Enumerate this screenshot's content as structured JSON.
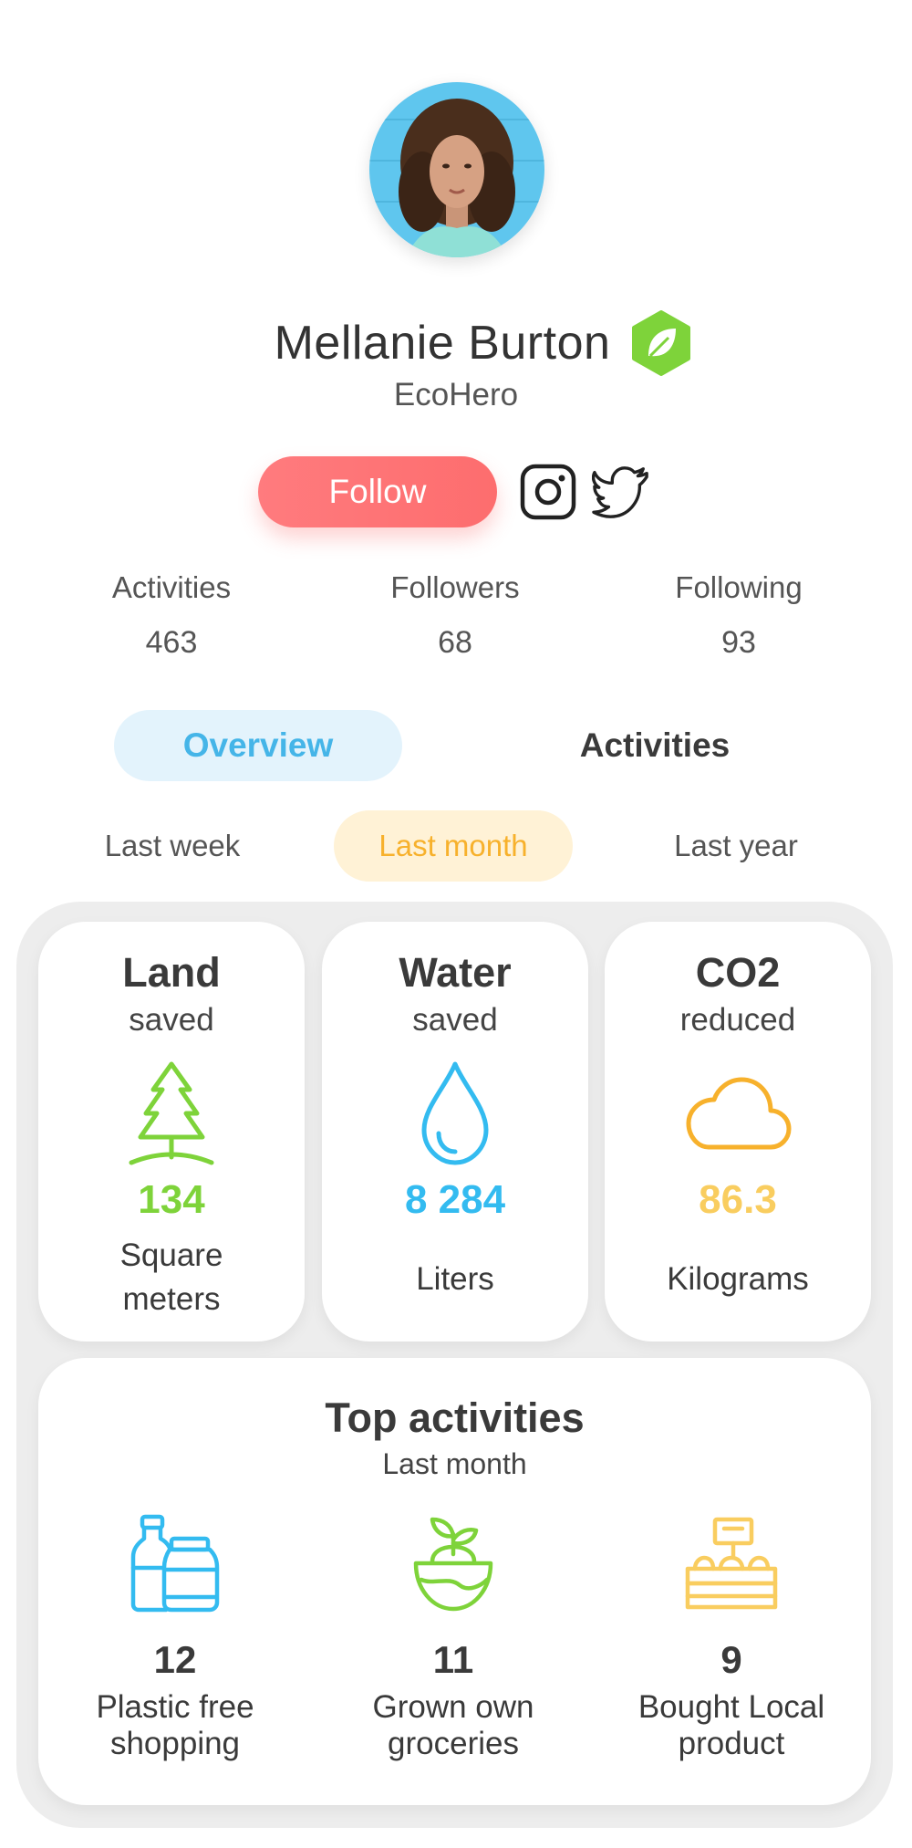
{
  "profile": {
    "name": "Mellanie Burton",
    "subtitle": "EcoHero"
  },
  "actions": {
    "follow_label": "Follow",
    "socials": [
      "instagram-icon",
      "twitter-icon"
    ]
  },
  "stats": [
    {
      "label": "Activities",
      "value": "463"
    },
    {
      "label": "Followers",
      "value": "68"
    },
    {
      "label": "Following",
      "value": "93"
    }
  ],
  "tabs": [
    {
      "label": "Overview",
      "active": true
    },
    {
      "label": "Activities",
      "active": false
    }
  ],
  "periods": [
    {
      "label": "Last week",
      "active": false
    },
    {
      "label": "Last month",
      "active": true
    },
    {
      "label": "Last year",
      "active": false
    }
  ],
  "metrics": [
    {
      "title": "Land",
      "sub": "saved",
      "value": "134",
      "unit": "Square meters",
      "icon": "tree-icon",
      "color": "#7ed33a"
    },
    {
      "title": "Water",
      "sub": "saved",
      "value": "8 284",
      "unit": "Liters",
      "icon": "water-drop-icon",
      "color": "#33bbf0"
    },
    {
      "title": "CO2",
      "sub": "reduced",
      "value": "86.3",
      "unit": "Kilograms",
      "icon": "cloud-icon",
      "color": "#f7b12c"
    }
  ],
  "top_activities": {
    "title": "Top activities",
    "sub": "Last month",
    "items": [
      {
        "count": "12",
        "label": "Plastic free shopping",
        "icon": "bottle-jar-icon",
        "color": "#33bbf0"
      },
      {
        "count": "11",
        "label": "Grown own groceries",
        "icon": "sprout-bowl-icon",
        "color": "#7ed33a"
      },
      {
        "count": "9",
        "label": "Bought Local product",
        "icon": "market-crate-icon",
        "color": "#f9cd5f"
      }
    ]
  },
  "colors": {
    "follow": "#fd6d6e",
    "overview_tab_bg": "#e3f3fc",
    "overview_tab_text": "#45b5e8",
    "period_active_bg": "#fff2d6",
    "period_active_text": "#f7b12c",
    "eco_badge": "#7ed33a"
  }
}
